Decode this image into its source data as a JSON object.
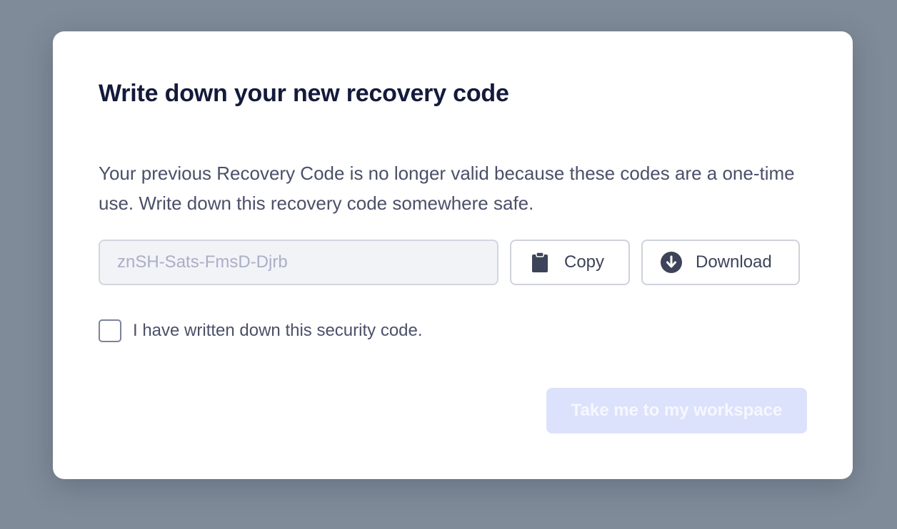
{
  "dialog": {
    "title": "Write down your new recovery code",
    "description": "Your previous Recovery Code is no longer valid because these codes are a one-time use. Write down this recovery code somewhere safe.",
    "recovery_code": {
      "value": "znSH-Sats-FmsD-Djrb"
    },
    "copy_button": {
      "label": "Copy",
      "icon": "clipboard-icon"
    },
    "download_button": {
      "label": "Download",
      "icon": "download-circle-icon"
    },
    "confirm_checkbox": {
      "label": "I have written down this security code.",
      "checked": false
    },
    "primary_button": {
      "label": "Take me to my workspace",
      "disabled": true
    }
  },
  "colors": {
    "backdrop": "#7f8b99",
    "title_text": "#141a3b",
    "body_text": "#4b5068",
    "disabled_primary_bg": "#dce2fb"
  }
}
